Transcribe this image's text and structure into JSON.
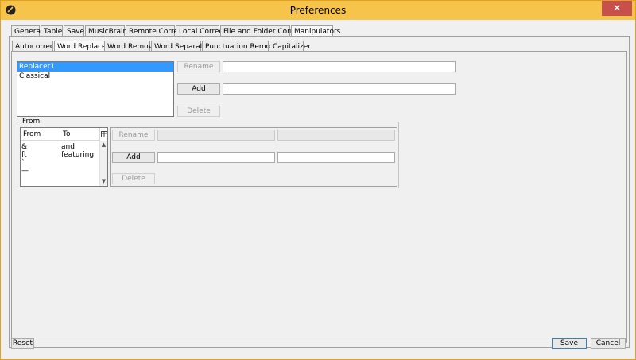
{
  "window": {
    "title": "Preferences",
    "close_glyph": "✕"
  },
  "top_tabs": [
    "General",
    "Table",
    "Save",
    "MusicBrainz",
    "Remote Correct",
    "Local Correct",
    "File and Folder Correct",
    "Manipulators"
  ],
  "sub_tabs": [
    "Autocorrector",
    "Word Replacer",
    "Word Remover",
    "Word Separator",
    "Punctuation Remover",
    "Capitalizer"
  ],
  "replacer_list": [
    "Replacer1",
    "Classical"
  ],
  "buttons": {
    "rename": "Rename",
    "add": "Add",
    "delete": "Delete"
  },
  "group": {
    "label": "From",
    "columns": [
      "From",
      "To"
    ],
    "rows": [
      {
        "from": "&",
        "to": "and"
      },
      {
        "from": "ft",
        "to": "featuring"
      },
      {
        "from": "`",
        "to": ""
      },
      {
        "from": "—",
        "to": ""
      }
    ],
    "rename": "Rename",
    "add": "Add",
    "delete": "Delete",
    "scroll_up": "▲",
    "scroll_down": "▼"
  },
  "footer": {
    "reset": "Reset",
    "save": "Save",
    "cancel": "Cancel"
  },
  "colors": {
    "title_bar": "#f6c44a",
    "selection": "#3399ff",
    "close": "#c7504b"
  },
  "icons": {
    "app": "app-icon",
    "columns": "column-settings-icon"
  }
}
